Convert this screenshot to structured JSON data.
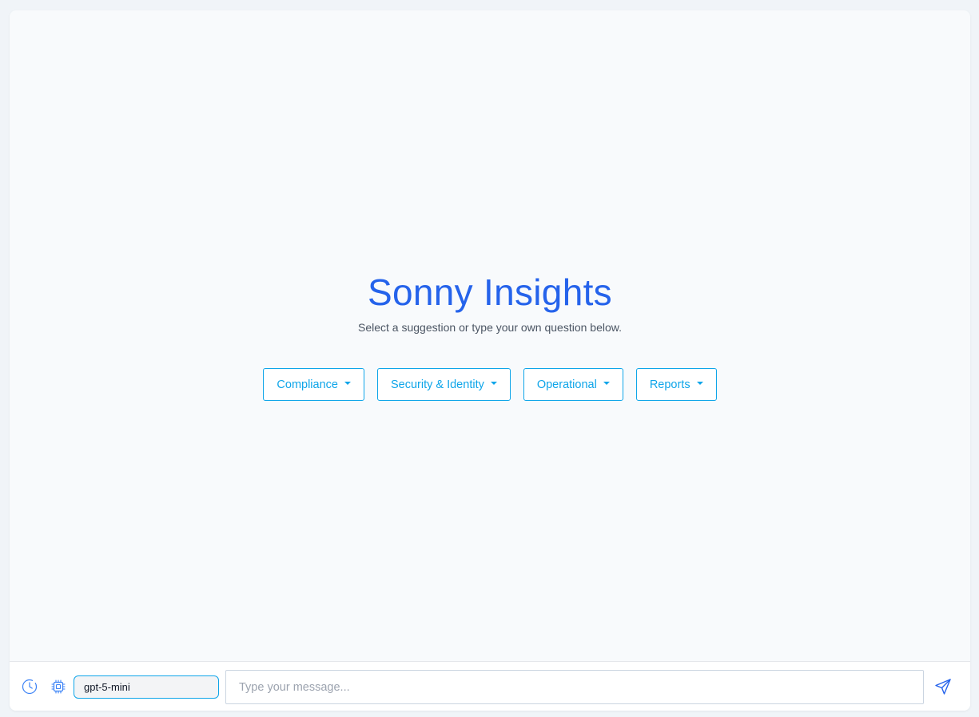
{
  "welcome": {
    "title": "Sonny Insights",
    "subtitle": "Select a suggestion or type your own question below."
  },
  "suggestions": [
    {
      "label": "Compliance",
      "icon": "caret-down-icon"
    },
    {
      "label": "Security & Identity",
      "icon": "caret-down-icon"
    },
    {
      "label": "Operational",
      "icon": "caret-down-icon"
    },
    {
      "label": "Reports",
      "icon": "caret-down-icon"
    }
  ],
  "bottom_bar": {
    "history_icon": "clock-icon",
    "model_icon": "chip-icon",
    "model_value": "gpt-5-mini",
    "message_placeholder": "Type your message...",
    "send_icon": "send-icon"
  },
  "colors": {
    "title": "#2563eb",
    "accent": "#0ea5e9",
    "background": "#f8fafc"
  }
}
